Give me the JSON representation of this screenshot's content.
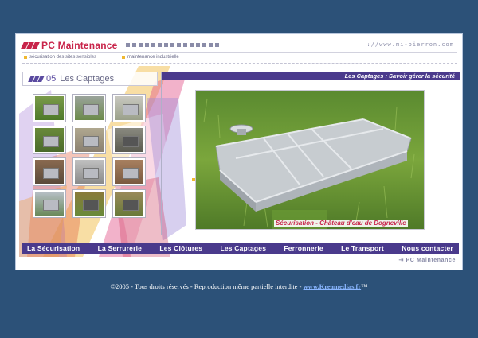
{
  "header": {
    "logo_text": "PC Maintenance",
    "url": "://www.mi-pierron.com",
    "sublinks": [
      "sécurisation des sites sensibles",
      "maintenance industrielle"
    ]
  },
  "section": {
    "number": "05",
    "title": "Les Captages"
  },
  "banner": "Les Captages : Savoir gérer la sécurité",
  "photo": {
    "caption": "Sécurisation - Château d'eau de Dogneville"
  },
  "nav": {
    "items": [
      "La Sécurisation",
      "La Serrurerie",
      "Les Clôtures",
      "Les Captages",
      "Ferronnerie",
      "Le Transport",
      "Nous contacter"
    ]
  },
  "footer_brand": "PC Maintenance",
  "copyright": {
    "text": "©2005 - Tous droits réservés - Reproduction même partielle interdite - ",
    "link": "www.Kreamedias.fr",
    "tm": "™"
  },
  "colors": {
    "page_background": "#2c5178",
    "brand_red": "#c8244a",
    "nav_purple": "#4a3a8c",
    "accent_yellow": "#f0b830"
  },
  "icons": {
    "logo": "double-chevron-logo-icon",
    "section": "double-chevron-section-icon",
    "footer": "right-arrow-icon"
  }
}
